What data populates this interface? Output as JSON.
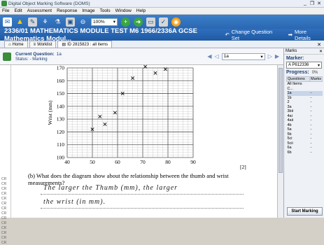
{
  "window": {
    "title": "Digital Object Marking Software (DOMS)",
    "controls": [
      "_",
      "❐",
      "✕"
    ]
  },
  "menu": [
    "File",
    "Edit",
    "Assessment",
    "Response",
    "Image",
    "Tools",
    "Window",
    "Help"
  ],
  "toolbar": {
    "zoom_value": "100%"
  },
  "header": {
    "title": "2336/01 MATHEMATICS MODULE TEST M6 1966/2336A GCSE Mathematics Modul...",
    "change_question": "Change Question Set",
    "more_details": "More Details"
  },
  "tabs": [
    {
      "label": "Home"
    },
    {
      "label": "Worklist"
    },
    {
      "label": "ID 2815823 : all items"
    }
  ],
  "question": {
    "current_label": "Current Question:",
    "current_value": "1a",
    "status_label": "Status:",
    "status_value": "- Marking",
    "selector_value": "1a"
  },
  "script": {
    "mark_label": "[2]",
    "question_b": "(b)   What does the diagram show about the relationship between the thumb and wrist measurements?",
    "answer_line1": "The   larger   the   Thumb  (mm),   the   larger",
    "answer_line2": "the   wrist   (in mm).",
    "margin_letters": [
      "CR",
      "CR",
      "CR",
      "CR",
      "CR",
      "CR",
      "CR",
      "CR",
      "CR",
      "CR",
      "CR",
      "CR",
      "CR",
      "CR"
    ]
  },
  "chart_data": {
    "type": "scatter",
    "xlabel": "Thumb (mm)",
    "ylabel": "Wrist (mm)",
    "xlim": [
      40,
      90
    ],
    "ylim": [
      100,
      170
    ],
    "x_ticks": [
      "40",
      "50",
      "60",
      "70",
      "80",
      "90"
    ],
    "y_ticks": [
      "100",
      "110",
      "120",
      "130",
      "140",
      "150",
      "160",
      "170"
    ],
    "points": [
      {
        "x": 50,
        "y": 122
      },
      {
        "x": 53,
        "y": 132
      },
      {
        "x": 55,
        "y": 126
      },
      {
        "x": 59,
        "y": 135
      },
      {
        "x": 62,
        "y": 150
      },
      {
        "x": 66,
        "y": 162
      },
      {
        "x": 71,
        "y": 171
      },
      {
        "x": 75,
        "y": 166
      },
      {
        "x": 79,
        "y": 169
      }
    ],
    "grid": true
  },
  "panel": {
    "title": "Marks",
    "marker_label": "Marker:",
    "marker_value": "A P612336",
    "progress_label": "Progress:",
    "progress_value": "0%",
    "col_questions": "Questions",
    "col_marks": "Marks",
    "rows": [
      {
        "q": "All Items C...",
        "m": ""
      },
      {
        "q": "1a",
        "m": "-"
      },
      {
        "q": "1b",
        "m": "-"
      },
      {
        "q": "2",
        "m": "-"
      },
      {
        "q": "3a",
        "m": "-"
      },
      {
        "q": "3bii",
        "m": "-"
      },
      {
        "q": "4ai",
        "m": "-"
      },
      {
        "q": "4aii",
        "m": "-"
      },
      {
        "q": "4b",
        "m": "-"
      },
      {
        "q": "5a",
        "m": "-"
      },
      {
        "q": "5b",
        "m": "-"
      },
      {
        "q": "5ci",
        "m": "-"
      },
      {
        "q": "5cii",
        "m": "-"
      },
      {
        "q": "6a",
        "m": "-"
      },
      {
        "q": "6b",
        "m": "-"
      }
    ],
    "start_button": "Start Marking"
  }
}
